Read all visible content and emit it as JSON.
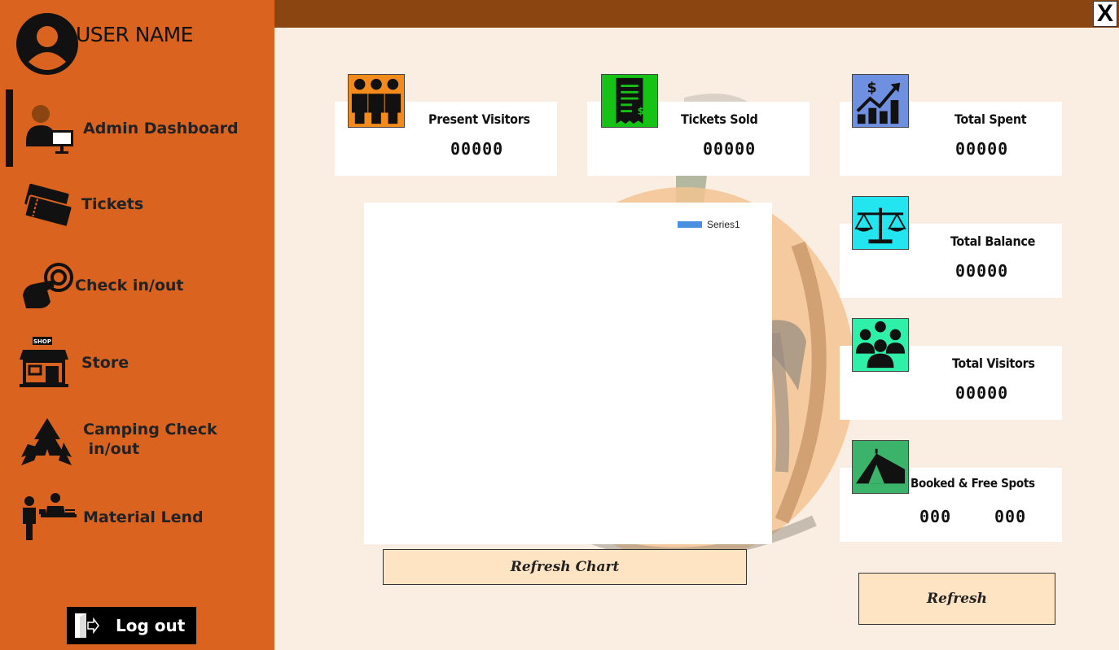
{
  "sidebar": {
    "user_name": "USER NAME",
    "nav": [
      {
        "label": "Admin Dashboard",
        "icon": "admin-icon",
        "active": true
      },
      {
        "label": "Tickets",
        "icon": "tickets-icon"
      },
      {
        "label": "Check in/out",
        "icon": "check-in-icon"
      },
      {
        "label": "Store",
        "icon": "shop-icon"
      },
      {
        "label": "Camping Check\n in/out",
        "icon": "camping-icon"
      },
      {
        "label": "Material Lend",
        "icon": "material-lend-icon"
      }
    ],
    "logout_label": "Log out"
  },
  "window": {
    "close_label": "X"
  },
  "cards": {
    "present_visitors": {
      "label": "Present Visitors",
      "value": "00000",
      "icon_color": "#f28a1c"
    },
    "tickets_sold": {
      "label": "Tickets Sold",
      "value": "00000",
      "icon_color": "#15c215"
    },
    "total_spent": {
      "label": "Total Spent",
      "value": "00000",
      "icon_color": "#6f8fe0"
    },
    "total_balance": {
      "label": "Total Balance",
      "value": "00000",
      "icon_color": "#22e5f0"
    },
    "total_visitors": {
      "label": "Total Visitors",
      "value": "00000",
      "icon_color": "#2ff0a8"
    },
    "spots": {
      "label": "Booked & Free Spots",
      "booked": "000",
      "free": "000",
      "icon_color": "#3bb36b"
    }
  },
  "chart_data": {
    "type": "bar",
    "series": [
      {
        "name": "Series1",
        "values": []
      }
    ],
    "legend_position": "top-right",
    "color": "#4a90e2"
  },
  "buttons": {
    "refresh_chart": "Refresh Chart",
    "refresh": "Refresh"
  }
}
